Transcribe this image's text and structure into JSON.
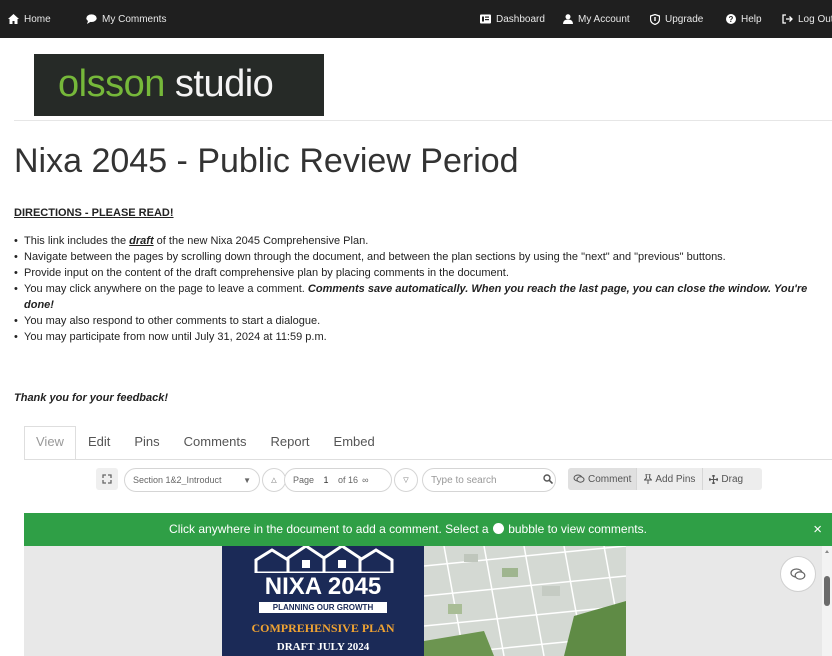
{
  "topnav": {
    "home": "Home",
    "my_comments": "My Comments",
    "dashboard": "Dashboard",
    "my_account": "My Account",
    "upgrade": "Upgrade",
    "help": "Help",
    "logout": "Log Out"
  },
  "logo": {
    "part1": "olsson",
    "part2": " studio",
    "brand_green": "#76b83a"
  },
  "page_title": "Nixa 2045 - Public Review Period",
  "directions": {
    "heading": "DIRECTIONS - PLEASE READ!",
    "item1_pre": "This link includes the ",
    "item1_em": "draft",
    "item1_post": " of the new Nixa 2045 Comprehensive Plan.",
    "item2": "Navigate between the pages by scrolling down through the document, and between the plan sections by using the \"next\" and \"previous\" buttons.",
    "item3": "Provide input on the content of the draft comprehensive plan by placing comments in the document.",
    "item4_pre": "You may click anywhere on the page to leave a comment. ",
    "item4_em": "Comments save automatically. When you reach the last page, you can close the window. You're done!",
    "item5": "You may also respond to other comments to start a dialogue.",
    "item6": "You may participate from now until July 31, 2024 at 11:59 p.m.",
    "thanks": "Thank you for your feedback!"
  },
  "tabs": [
    "View",
    "Edit",
    "Pins",
    "Comments",
    "Report",
    "Embed"
  ],
  "toolbar": {
    "section_select": "Section 1&2_Introduct",
    "page_label": "Page",
    "page_value": "1",
    "page_of": "of 16",
    "search_placeholder": "Type to search",
    "comment_btn": "Comment",
    "add_pins_btn": "Add Pins",
    "drag_btn": "Drag"
  },
  "banner": {
    "msg_before": "Click anywhere in the document to add a comment. Select a ",
    "msg_after": " bubble to view comments.",
    "close": "×",
    "color": "#2f9f46"
  },
  "document": {
    "cover_title": "NIXA 2045",
    "cover_subtitle": "PLANNING OUR GROWTH",
    "cover_plan": "COMPREHENSIVE PLAN",
    "cover_draft": "DRAFT JULY 2024"
  }
}
